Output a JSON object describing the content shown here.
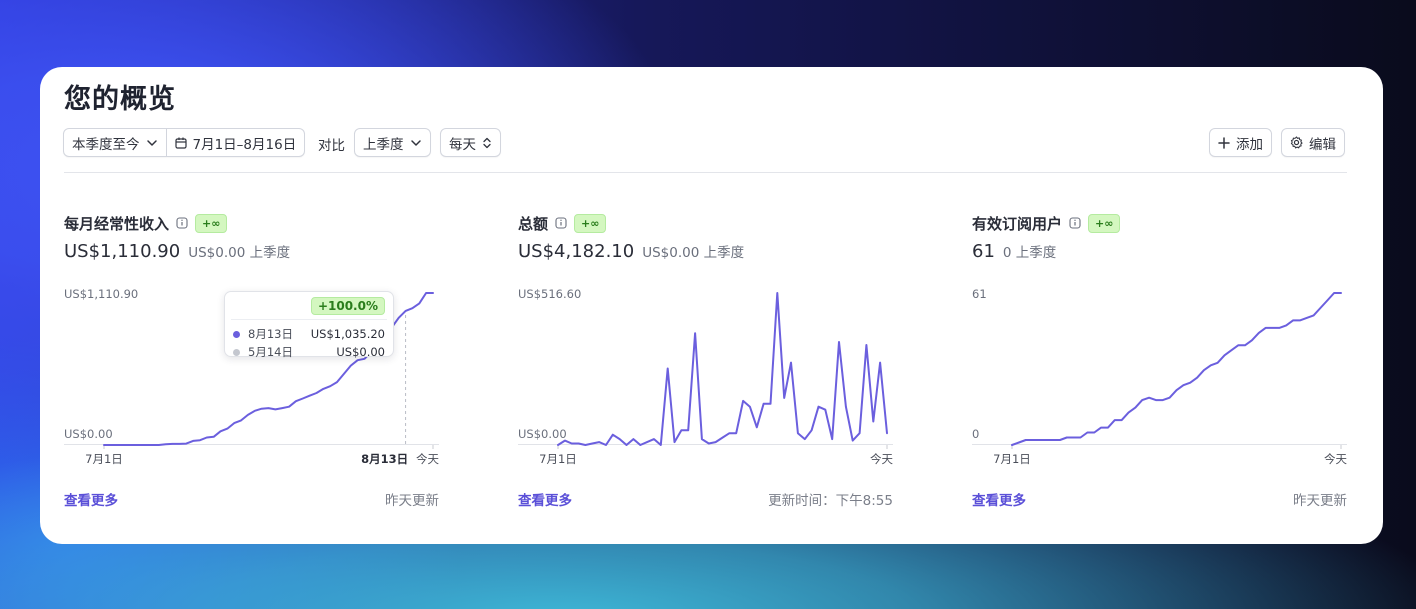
{
  "page": {
    "title": "您的概览"
  },
  "toolbar": {
    "range_preset": "本季度至今",
    "date_range": "7月1日–8月16日",
    "compare_label": "对比",
    "compare_value": "上季度",
    "interval": "每天",
    "add_label": "添加",
    "edit_label": "编辑"
  },
  "colors": {
    "accent": "#6b5fde",
    "link": "#5b50d8",
    "badge_bg": "#d4f7c0",
    "badge_text": "#2a7d1c"
  },
  "panels": [
    {
      "title": "每月经常性收入",
      "badge": "+∞",
      "value": "US$1,110.90",
      "compare": "US$0.00 上季度",
      "more": "查看更多",
      "updated": "昨天更新",
      "tooltip": {
        "change": "+100.0%",
        "rows": [
          {
            "date": "8月13日",
            "value": "US$1,035.20"
          },
          {
            "date": "5月14日",
            "value": "US$0.00"
          }
        ]
      }
    },
    {
      "title": "总额",
      "badge": "+∞",
      "value": "US$4,182.10",
      "compare": "US$0.00 上季度",
      "more": "查看更多",
      "updated": "更新时间：下午8:55"
    },
    {
      "title": "有效订阅用户",
      "badge": "+∞",
      "value": "61",
      "compare": "0 上季度",
      "more": "查看更多",
      "updated": "昨天更新"
    }
  ],
  "chart_data": [
    {
      "type": "line",
      "ymax_label": "US$1,110.90",
      "ymin_label": "US$0.00",
      "x_start_label": "7月1日",
      "x_end_label": "今天",
      "hover_label": "8月13日",
      "hover_index": 44,
      "ylim": [
        0,
        1110.9
      ],
      "values": [
        0,
        0,
        0,
        0,
        0,
        0,
        0,
        0,
        0,
        5,
        8,
        8,
        10,
        30,
        35,
        55,
        60,
        100,
        120,
        160,
        180,
        220,
        250,
        265,
        270,
        260,
        270,
        280,
        320,
        340,
        360,
        380,
        410,
        430,
        460,
        520,
        580,
        620,
        630,
        680,
        720,
        780,
        860,
        930,
        980,
        1000,
        1035.2,
        1110.9,
        1110.9
      ]
    },
    {
      "type": "line",
      "ymax_label": "US$516.60",
      "ymin_label": "US$0.00",
      "x_start_label": "7月1日",
      "x_end_label": "今天",
      "ylim": [
        0,
        516.6
      ],
      "values": [
        0,
        15,
        5,
        5,
        0,
        5,
        10,
        0,
        35,
        20,
        0,
        20,
        0,
        10,
        20,
        0,
        260,
        10,
        50,
        50,
        380,
        20,
        5,
        10,
        25,
        40,
        40,
        150,
        130,
        60,
        140,
        140,
        516.6,
        160,
        280,
        40,
        20,
        50,
        130,
        120,
        20,
        350,
        130,
        15,
        40,
        340,
        80,
        280,
        40
      ]
    },
    {
      "type": "line",
      "ymax_label": "61",
      "ymin_label": "0",
      "x_start_label": "7月1日",
      "x_end_label": "今天",
      "ylim": [
        0,
        61
      ],
      "values": [
        0,
        1,
        2,
        2,
        2,
        2,
        2,
        2,
        3,
        3,
        3,
        5,
        5,
        7,
        7,
        10,
        10,
        13,
        15,
        18,
        19,
        18,
        18,
        19,
        22,
        24,
        25,
        27,
        30,
        32,
        33,
        36,
        38,
        40,
        40,
        42,
        45,
        47,
        47,
        47,
        48,
        50,
        50,
        51,
        52,
        55,
        58,
        61,
        61
      ]
    }
  ]
}
